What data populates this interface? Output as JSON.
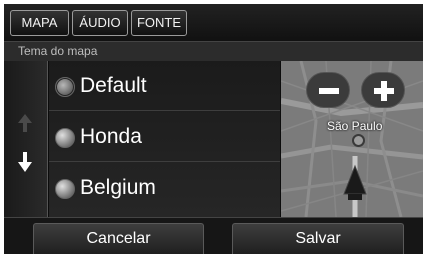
{
  "tabs": [
    {
      "label": "MAPA"
    },
    {
      "label": "ÁUDIO"
    },
    {
      "label": "FONTE"
    }
  ],
  "section": {
    "title": "Tema do mapa"
  },
  "themes": [
    {
      "label": "Default",
      "selected": true
    },
    {
      "label": "Honda",
      "selected": false
    },
    {
      "label": "Belgium",
      "selected": false
    }
  ],
  "map": {
    "zoom_out": "minus-icon",
    "zoom_in": "plus-icon",
    "city": "São Paulo"
  },
  "actions": {
    "cancel_label": "Cancelar",
    "save_label": "Salvar"
  }
}
